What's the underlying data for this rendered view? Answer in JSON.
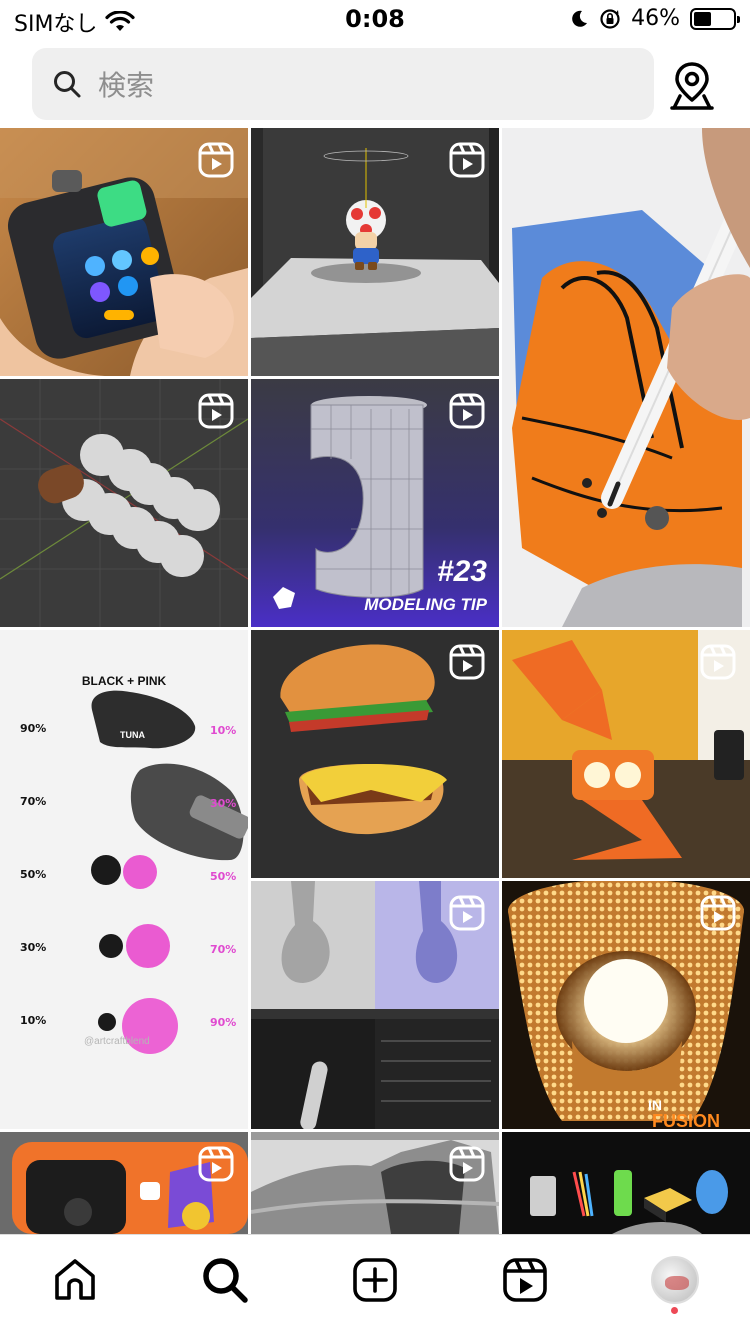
{
  "status_bar": {
    "carrier": "SIMなし",
    "time": "0:08",
    "battery_percent": "46%",
    "battery_level": 0.46
  },
  "search": {
    "placeholder": "検索"
  },
  "grid": {
    "tile_text": {
      "modeling_number": "#23",
      "modeling_tip": "MODELING TIP",
      "swatch_title": "BLACK + PINK",
      "swatch_label": "TUNA",
      "watermark": "@artcraftblend",
      "left_percents": [
        "90%",
        "70%",
        "50%",
        "30%",
        "10%"
      ],
      "right_percents": [
        "10%",
        "30%",
        "50%",
        "70%",
        "90%"
      ],
      "fusion_in": "IN",
      "fusion_word": "FUSION"
    }
  },
  "colors": {
    "accent_notification": "#ed4956",
    "pink": "#e04ad0",
    "search_bg": "#efefef"
  },
  "icons": {
    "nav": [
      "home-icon",
      "search-icon",
      "create-icon",
      "reels-icon",
      "profile-avatar"
    ]
  }
}
